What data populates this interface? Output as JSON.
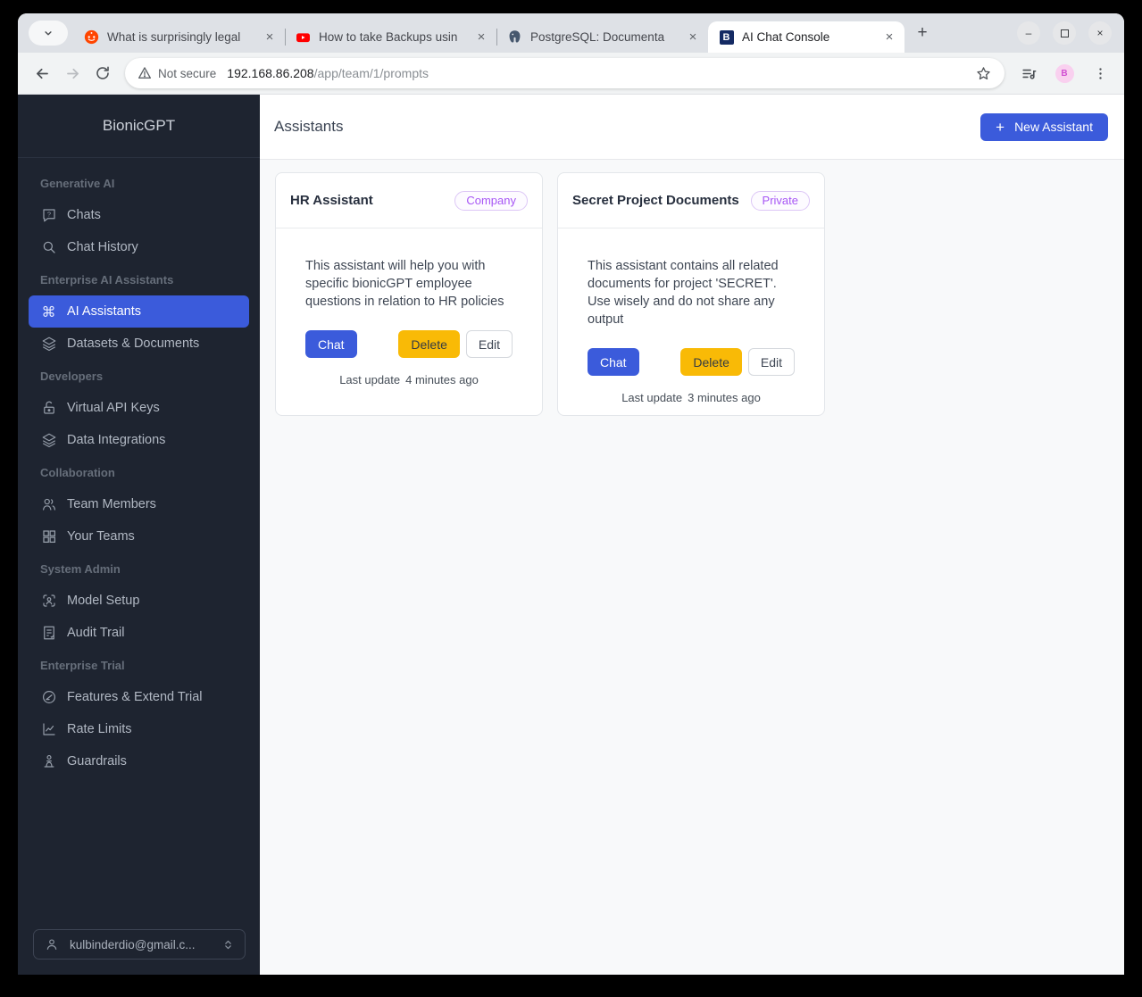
{
  "glyphs": {
    "close_tab": "×",
    "new_tab": "+",
    "minimize": "–",
    "close_window": "×",
    "command": "⌘",
    "plus": "+"
  },
  "colors": {
    "accent_blue": "#3b5bdb",
    "delete_yellow": "#f9ba06",
    "badge_purple": "#a756f5",
    "sidebar_bg": "#1e2430",
    "tabstrip_bg": "#dee1e6"
  },
  "browser": {
    "tabs": [
      {
        "title": "What is surprisingly legal",
        "icon": "reddit-icon"
      },
      {
        "title": "How to take Backups usin",
        "icon": "youtube-icon"
      },
      {
        "title": "PostgreSQL: Documenta",
        "icon": "postgresql-icon"
      },
      {
        "title": "AI Chat Console",
        "icon": "bionicgpt-favicon",
        "favicon_letter": "B"
      }
    ],
    "address": {
      "security": "Not secure",
      "host": "192.168.86.208",
      "path": "/app/team/1/prompts"
    },
    "extension_letter": "B"
  },
  "sidebar": {
    "brand": "BionicGPT",
    "sections": [
      {
        "label": "Generative AI",
        "items": [
          {
            "label": "Chats",
            "icon": "chat-question-icon"
          },
          {
            "label": "Chat History",
            "icon": "search-icon"
          }
        ]
      },
      {
        "label": "Enterprise AI Assistants",
        "items": [
          {
            "label": "AI Assistants",
            "icon": "command-icon"
          },
          {
            "label": "Datasets & Documents",
            "icon": "layers-icon"
          }
        ]
      },
      {
        "label": "Developers",
        "items": [
          {
            "label": "Virtual API Keys",
            "icon": "unlock-icon"
          },
          {
            "label": "Data Integrations",
            "icon": "layers-icon"
          }
        ]
      },
      {
        "label": "Collaboration",
        "items": [
          {
            "label": "Team Members",
            "icon": "users-icon"
          },
          {
            "label": "Your Teams",
            "icon": "grid-icon"
          }
        ]
      },
      {
        "label": "System Admin",
        "items": [
          {
            "label": "Model Setup",
            "icon": "user-scan-icon"
          },
          {
            "label": "Audit Trail",
            "icon": "audit-document-icon"
          }
        ]
      },
      {
        "label": "Enterprise Trial",
        "items": [
          {
            "label": "Features & Extend Trial",
            "icon": "gauge-icon"
          },
          {
            "label": "Rate Limits",
            "icon": "chart-icon"
          },
          {
            "label": "Guardrails",
            "icon": "guardrail-icon"
          }
        ]
      }
    ],
    "user": {
      "email": "kulbinderdio@gmail.c..."
    }
  },
  "main": {
    "title": "Assistants",
    "new_assistant_label": "New Assistant",
    "cards": [
      {
        "title": "HR Assistant",
        "badge": "Company",
        "description": "This assistant will help you with specific bionicGPT employee questions in relation to HR policies",
        "chat_label": "Chat",
        "delete_label": "Delete",
        "edit_label": "Edit",
        "last_update_label": "Last update",
        "last_update_value": "4 minutes ago"
      },
      {
        "title": "Secret Project Documents",
        "badge": "Private",
        "description": "This assistant contains all related documents for project 'SECRET'. Use wisely and do not share any output",
        "chat_label": "Chat",
        "delete_label": "Delete",
        "edit_label": "Edit",
        "last_update_label": "Last update",
        "last_update_value": "3 minutes ago"
      }
    ]
  }
}
